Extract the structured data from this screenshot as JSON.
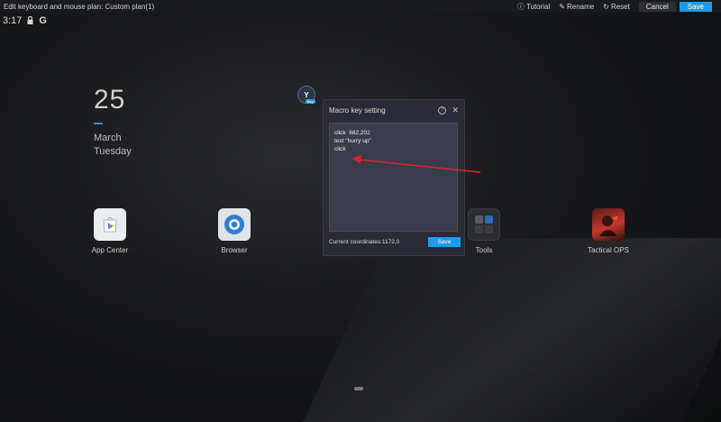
{
  "topbar": {
    "title": "Edit keyboard and mouse plan: Custom plan(1)",
    "tutorial_label": "Tutorial",
    "rename_label": "Rename",
    "reset_label": "Reset",
    "cancel_label": "Cancel",
    "save_label": "Save"
  },
  "status_bar": {
    "time": "3:17",
    "g_label": "G"
  },
  "date_widget": {
    "day": "25",
    "month": "March",
    "weekday": "Tuesday"
  },
  "apps": [
    {
      "label": "App Center",
      "icon": "play-store-icon"
    },
    {
      "label": "Browser",
      "icon": "browser-icon"
    },
    {
      "label": "Tools",
      "icon": "tools-folder-icon"
    },
    {
      "label": "Tactical OPS",
      "icon": "tactical-ops-icon"
    }
  ],
  "macro_badge": {
    "letter": "Y",
    "sub": "key"
  },
  "dialog": {
    "title": "Macro key setting",
    "script_lines": "click  682,202\ntext \"hurry up\"\nclick",
    "coords": "Current coordinates:1172,0",
    "save_label": "Save"
  },
  "colors": {
    "accent": "#1d9bf0",
    "annotation": "#e0242b"
  }
}
